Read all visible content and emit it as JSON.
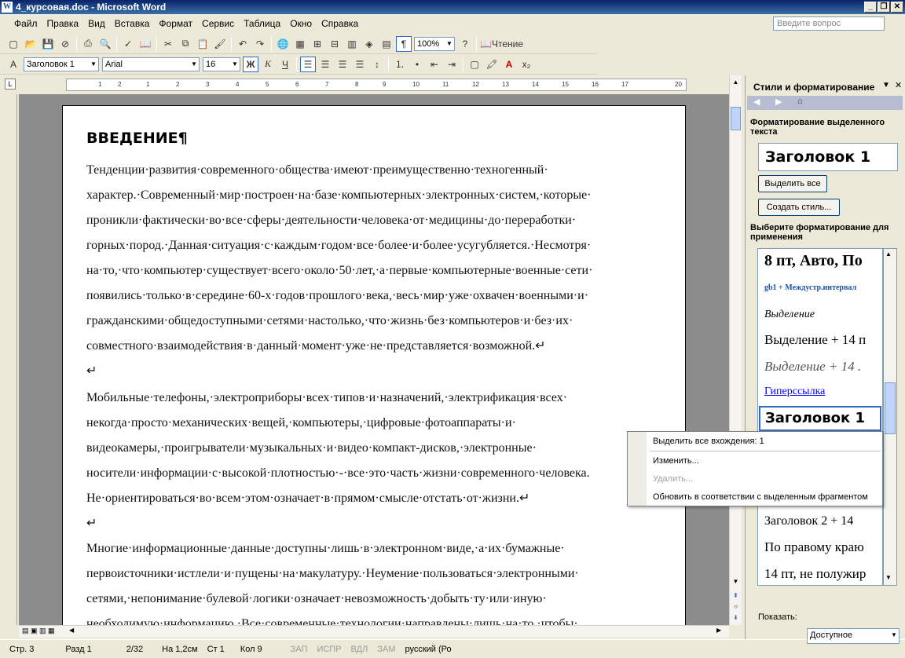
{
  "window": {
    "title": "4_курсовая.doc - Microsoft Word",
    "app_icon": "W"
  },
  "menu": {
    "items": [
      "Файл",
      "Правка",
      "Вид",
      "Вставка",
      "Формат",
      "Сервис",
      "Таблица",
      "Окно",
      "Справка"
    ],
    "ask_placeholder": "Введите вопрос"
  },
  "toolbar": {
    "zoom": "100%",
    "read_label": "Чтение"
  },
  "format_bar": {
    "style": "Заголовок 1",
    "font": "Arial",
    "size": "16",
    "bold": "Ж",
    "italic": "К",
    "underline": "Ч"
  },
  "ruler": {
    "marks": [
      "1",
      "2",
      "1",
      "2",
      "3",
      "4",
      "5",
      "6",
      "7",
      "8",
      "9",
      "10",
      "11",
      "12",
      "13",
      "14",
      "15",
      "16",
      "17",
      "20"
    ]
  },
  "document": {
    "heading": "ВВЕДЕНИЕ¶",
    "lines": [
      "Тенденции·развития·современного·общества·имеют·преимущественно·техногенный·",
      "характер.·Современный·мир·построен·на·базе·компьютерных·электронных·систем,·которые·",
      "проникли·фактически·во·все·сферы·деятельности·человека·от·медицины·до·переработки·",
      "горных·пород.·Данная·ситуация·с·каждым·годом·все·более·и·более·усугубляется.·Несмотря·",
      "на·то,·что·компьютер·существует·всего·около·50·лет,·а·первые·компьютерные·военные·сети·",
      "появились·только·в·середине·60-х·годов·прошлого·века,·весь·мир·уже·охвачен·военными·и·",
      "гражданскими·общедоступными·сетями·настолько,·что·жизнь·без·компьютеров·и·без·их·",
      "совместного·взаимодействия·в·данный·момент·уже·не·представляется·возможной.↵",
      "↵",
      "Мобильные·телефоны,·электроприборы·всех·типов·и·назначений,·электрификация·всех·",
      "некогда·просто·механических·вещей,·компьютеры,·цифровые·фотоаппараты·и·",
      "видеокамеры,·проигрыватели·музыкальных·и·видео·компакт-дисков,·электронные·",
      "носители·информации·с·высокой·плотностью·-·все·это·часть·жизни·современного·человека.",
      "Не·ориентироваться·во·всем·этом·означает·в·прямом·смысле·отстать·от·жизни.↵",
      "↵",
      "Многие·информационные·данные·доступны·лишь·в·электронном·виде,·а·их·бумажные·",
      "первоисточники·истлели·и·пущены·на·макулатуру.·Неумение·пользоваться·электронными·",
      "сетями,·непонимание·булевой·логики·означает·невозможность·добыть·ту·или·иную·",
      "необходимую·информацию.·Все·современные·технологии·направлены·лишь·на·то,·чтобы·"
    ]
  },
  "status": {
    "page": "Стр. 3",
    "section": "Разд 1",
    "pages": "2/32",
    "at": "На 1,2см",
    "line": "Ст 1",
    "col": "Кол 9",
    "rec": "ЗАП",
    "trk": "ИСПР",
    "ext": "ВДЛ",
    "ovr": "ЗАМ",
    "lang": "русский (Ро"
  },
  "pane": {
    "title": "Стили и форматирование",
    "selected_label": "Форматирование выделенного текста",
    "selected_style": "Заголовок 1",
    "select_all": "Выделить все",
    "new_style": "Создать стиль...",
    "choose_label": "Выберите форматирование для применения",
    "styles": [
      "8 пт, Авто, По",
      "gb1 + Междустр.интервал",
      "Выделение",
      "Выделение + 14 п",
      "Выделение + 14 .",
      "Гиперссылка",
      "Заголовок 1",
      "Заголовок 2 + 14",
      "По правому краю",
      "14 пт, не полужир"
    ],
    "show_label": "Показать:",
    "show_value": "Доступное"
  },
  "context_menu": {
    "items": [
      "Выделить все вхождения: 1",
      "Изменить...",
      "Удалить...",
      "Обновить в соответствии с выделенным фрагментом"
    ]
  }
}
